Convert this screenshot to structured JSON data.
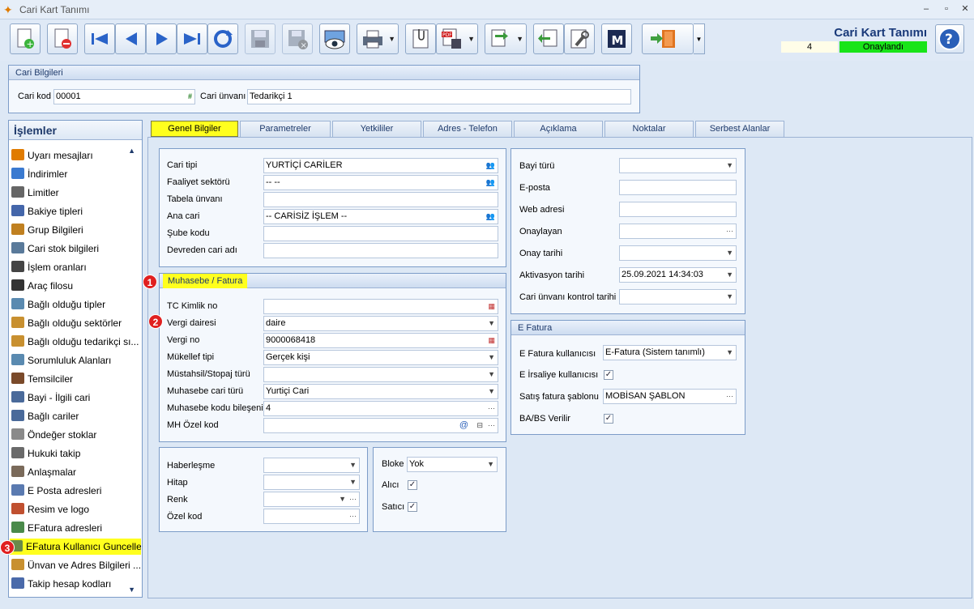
{
  "window": {
    "title": "Cari Kart Tanımı"
  },
  "toolbar": {
    "form_title": "Cari Kart Tanımı",
    "record_no": "4",
    "status": "Onaylandı",
    "status_color": "#19e419"
  },
  "cari": {
    "header": "Cari Bilgileri",
    "kod_label": "Cari kod",
    "kod_value": "00001",
    "unvan_label": "Cari ünvanı",
    "unvan_value": "Tedarikçi 1"
  },
  "left": {
    "header": "İşlemler",
    "items": [
      "Uyarı mesajları",
      "İndirimler",
      "Limitler",
      "Bakiye tipleri",
      "Grup Bilgileri",
      "Cari stok bilgileri",
      "İşlem oranları",
      "Araç filosu",
      "Bağlı olduğu tipler",
      "Bağlı olduğu sektörler",
      "Bağlı olduğu tedarikçi sı...",
      "Sorumluluk Alanları",
      "Temsilciler",
      "Bayi - İlgili cari",
      "Bağlı cariler",
      "Öndeğer stoklar",
      "Hukuki takip",
      "Anlaşmalar",
      "E Posta adresleri",
      "Resim ve logo",
      "EFatura adresleri",
      "EFatura Kullanıcı Guncelle",
      "Ünvan ve Adres Bilgileri ...",
      "Takip hesap kodları"
    ]
  },
  "tabs": [
    "Genel Bilgiler",
    "Parametreler",
    "Yetkililer",
    "Adres - Telefon",
    "Açıklama",
    "Noktalar",
    "Serbest Alanlar"
  ],
  "genel": {
    "cari_tipi_label": "Cari tipi",
    "cari_tipi": "YURTİÇİ CARİLER",
    "faaliyet_label": "Faaliyet sektörü",
    "faaliyet": "-- --",
    "tabela_label": "Tabela ünvanı",
    "ana_cari_label": "Ana cari",
    "ana_cari": "-- CARİSİZ İŞLEM --",
    "sube_label": "Şube kodu",
    "devreden_label": "Devreden cari adı"
  },
  "muhasebe": {
    "header": "Muhasebe / Fatura",
    "tc_label": "TC Kimlik no",
    "vd_label": "Vergi dairesi",
    "vd": "daire",
    "vno_label": "Vergi no",
    "vno": "9000068418",
    "mukellef_label": "Mükellef tipi",
    "mukellef": "Gerçek kişi",
    "mustahsil_label": "Müstahsil/Stopaj türü",
    "mcari_label": "Muhasebe cari türü",
    "mcari": "Yurtiçi Cari",
    "mkod_label": "Muhasebe kodu bileşeni",
    "mkod": "4",
    "mh_label": "MH Özel kod"
  },
  "misc": {
    "haber_label": "Haberleşme",
    "hitap_label": "Hitap",
    "renk_label": "Renk",
    "ozel_label": "Özel kod",
    "bloke_label": "Bloke",
    "bloke": "Yok",
    "alici_label": "Alıcı",
    "satici_label": "Satıcı"
  },
  "right": {
    "bayi_label": "Bayi türü",
    "eposta_label": "E-posta",
    "web_label": "Web adresi",
    "onaylayan_label": "Onaylayan",
    "onay_tarihi_label": "Onay tarihi",
    "aktivasyon_label": "Aktivasyon tarihi",
    "aktivasyon": "25.09.2021 14:34:03",
    "kontrol_label": "Cari ünvanı kontrol tarihi"
  },
  "efatura": {
    "header": "E Fatura",
    "kullanici_label": "E Fatura kullanıcısı",
    "kullanici": "E-Fatura (Sistem tanımlı)",
    "irsaliye_label": "E İrsaliye kullanıcısı",
    "sablon_label": "Satış fatura şablonu",
    "sablon": "MOBİSAN ŞABLON",
    "babs_label": "BA/BS Verilir"
  },
  "badges": {
    "b1": "1",
    "b2": "2",
    "b3": "3"
  }
}
